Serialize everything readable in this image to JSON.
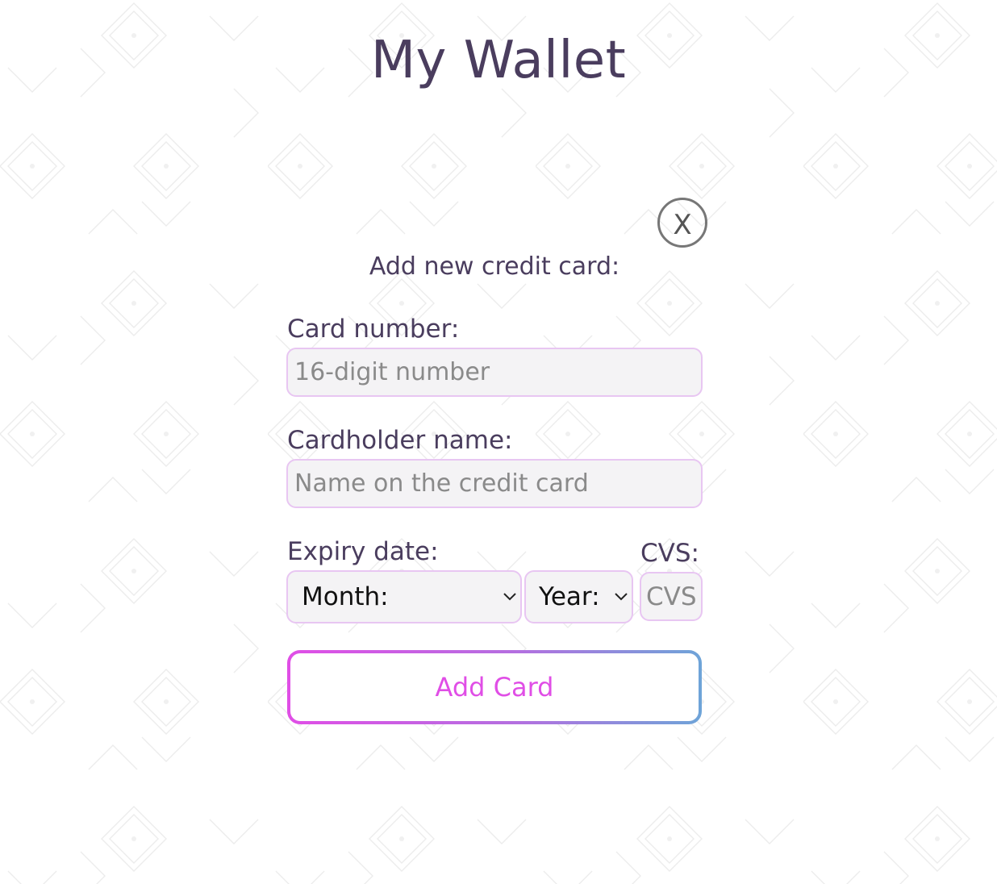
{
  "page": {
    "title": "My Wallet"
  },
  "dialog": {
    "close_label": "X",
    "heading": "Add new credit card:",
    "card_number": {
      "label": "Card number:",
      "placeholder": "16-digit number",
      "value": ""
    },
    "cardholder_name": {
      "label": "Cardholder name:",
      "placeholder": "Name on the credit card",
      "value": ""
    },
    "expiry": {
      "label": "Expiry date:",
      "month_selected": "Month:",
      "year_selected": "Year:"
    },
    "cvs": {
      "label": "CVS:",
      "placeholder": "CVS",
      "value": ""
    },
    "submit_label": "Add Card"
  },
  "colors": {
    "text": "#4a3d5e",
    "input_border": "#e8c6f2",
    "input_bg": "#f4f3f5",
    "button_gradient_start": "#e04ee6",
    "button_gradient_end": "#6ea4d8",
    "button_text": "#e04ee6"
  },
  "icons": {
    "close": "close-icon",
    "month_dropdown": "chevron-down-icon",
    "year_dropdown": "chevron-down-icon"
  }
}
